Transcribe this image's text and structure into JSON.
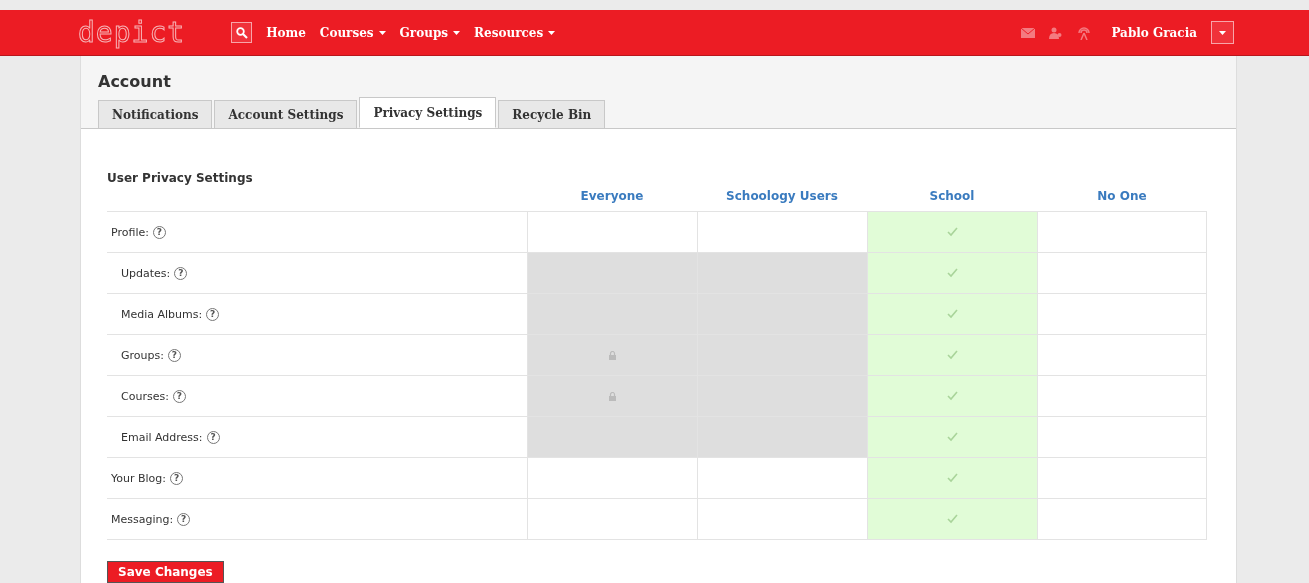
{
  "topbar": {
    "logo": "depict",
    "nav": [
      {
        "label": "Home",
        "dropdown": false
      },
      {
        "label": "Courses",
        "dropdown": true
      },
      {
        "label": "Groups",
        "dropdown": true
      },
      {
        "label": "Resources",
        "dropdown": true
      }
    ],
    "user": "Pablo Gracia"
  },
  "page_title": "Account",
  "tabs": [
    {
      "label": "Notifications",
      "selected": false
    },
    {
      "label": "Account Settings",
      "selected": false
    },
    {
      "label": "Privacy Settings",
      "selected": true
    },
    {
      "label": "Recycle Bin",
      "selected": false
    }
  ],
  "section_title": "User Privacy Settings",
  "columns": [
    "Everyone",
    "Schoology Users",
    "School",
    "No One"
  ],
  "rows": [
    {
      "label": "Profile:",
      "help": "?",
      "cells": [
        {
          "selected": false,
          "disabled": false,
          "locked": false
        },
        {
          "selected": false,
          "disabled": false,
          "locked": false
        },
        {
          "selected": true,
          "disabled": false,
          "locked": false
        },
        {
          "selected": false,
          "disabled": false,
          "locked": false
        }
      ],
      "children": [
        {
          "label": "Updates:",
          "help": "?",
          "cells": [
            {
              "selected": false,
              "disabled": true,
              "locked": false
            },
            {
              "selected": false,
              "disabled": true,
              "locked": false
            },
            {
              "selected": true,
              "disabled": false,
              "locked": false
            },
            {
              "selected": false,
              "disabled": false,
              "locked": false
            }
          ]
        },
        {
          "label": "Media Albums:",
          "help": "?",
          "cells": [
            {
              "selected": false,
              "disabled": true,
              "locked": false
            },
            {
              "selected": false,
              "disabled": true,
              "locked": false
            },
            {
              "selected": true,
              "disabled": false,
              "locked": false
            },
            {
              "selected": false,
              "disabled": false,
              "locked": false
            }
          ]
        },
        {
          "label": "Groups:",
          "help": "?",
          "cells": [
            {
              "selected": false,
              "disabled": true,
              "locked": true
            },
            {
              "selected": false,
              "disabled": true,
              "locked": false
            },
            {
              "selected": true,
              "disabled": false,
              "locked": false
            },
            {
              "selected": false,
              "disabled": false,
              "locked": false
            }
          ]
        },
        {
          "label": "Courses:",
          "help": "?",
          "cells": [
            {
              "selected": false,
              "disabled": true,
              "locked": true
            },
            {
              "selected": false,
              "disabled": true,
              "locked": false
            },
            {
              "selected": true,
              "disabled": false,
              "locked": false
            },
            {
              "selected": false,
              "disabled": false,
              "locked": false
            }
          ]
        },
        {
          "label": "Email Address:",
          "help": "?",
          "cells": [
            {
              "selected": false,
              "disabled": true,
              "locked": false
            },
            {
              "selected": false,
              "disabled": true,
              "locked": false
            },
            {
              "selected": true,
              "disabled": false,
              "locked": false
            },
            {
              "selected": false,
              "disabled": false,
              "locked": false
            }
          ]
        }
      ]
    },
    {
      "label": "Your Blog:",
      "help": "?",
      "cells": [
        {
          "selected": false,
          "disabled": false,
          "locked": false
        },
        {
          "selected": false,
          "disabled": false,
          "locked": false
        },
        {
          "selected": true,
          "disabled": false,
          "locked": false
        },
        {
          "selected": false,
          "disabled": false,
          "locked": false
        }
      ]
    },
    {
      "label": "Messaging:",
      "help": "?",
      "cells": [
        {
          "selected": false,
          "disabled": false,
          "locked": false
        },
        {
          "selected": false,
          "disabled": false,
          "locked": false
        },
        {
          "selected": true,
          "disabled": false,
          "locked": false
        },
        {
          "selected": false,
          "disabled": false,
          "locked": false
        }
      ]
    }
  ],
  "save_button": "Save Changes"
}
